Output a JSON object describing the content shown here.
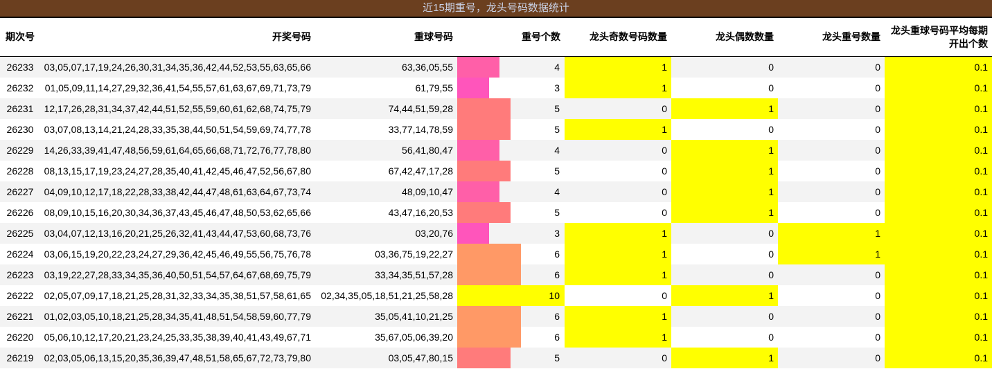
{
  "title": "近15期重号，龙头号码数据统计",
  "headers": {
    "period": "期次号",
    "draw": "开奖号码",
    "repeat": "重球号码",
    "count": "重号个数",
    "head_odd": "龙头奇数号码数量",
    "head_even": "龙头偶数数量",
    "head_repeat": "龙头重号数量",
    "avg_line1": "龙头重球号码平均每期",
    "avg_line2": "开出个数"
  },
  "bar_colors": {
    "3": "#ff55bb",
    "4": "#ff5fa8",
    "5": "#ff7b7b",
    "6": "#ff9966",
    "10": "#ffff00"
  },
  "highlight_color": "#ffff00",
  "rows": [
    {
      "period": "26233",
      "draw": "03,05,07,17,19,24,26,30,31,34,35,36,42,44,52,53,55,63,65,66",
      "repeat": "63,36,05,55",
      "count": 4,
      "odd": "1",
      "even": "0",
      "hrep": "0",
      "avg": "0.1"
    },
    {
      "period": "26232",
      "draw": "01,05,09,11,14,27,29,32,36,41,54,55,57,61,63,67,69,71,73,79",
      "repeat": "61,79,55",
      "count": 3,
      "odd": "1",
      "even": "0",
      "hrep": "0",
      "avg": "0.1"
    },
    {
      "period": "26231",
      "draw": "12,17,26,28,31,34,37,42,44,51,52,55,59,60,61,62,68,74,75,79",
      "repeat": "74,44,51,59,28",
      "count": 5,
      "odd": "0",
      "even": "1",
      "hrep": "0",
      "avg": "0.1"
    },
    {
      "period": "26230",
      "draw": "03,07,08,13,14,21,24,28,33,35,38,44,50,51,54,59,69,74,77,78",
      "repeat": "33,77,14,78,59",
      "count": 5,
      "odd": "1",
      "even": "0",
      "hrep": "0",
      "avg": "0.1"
    },
    {
      "period": "26229",
      "draw": "14,26,33,39,41,47,48,56,59,61,64,65,66,68,71,72,76,77,78,80",
      "repeat": "56,41,80,47",
      "count": 4,
      "odd": "0",
      "even": "1",
      "hrep": "0",
      "avg": "0.1"
    },
    {
      "period": "26228",
      "draw": "08,13,15,17,19,23,24,27,28,35,40,41,42,45,46,47,52,56,67,80",
      "repeat": "67,42,47,17,28",
      "count": 5,
      "odd": "0",
      "even": "1",
      "hrep": "0",
      "avg": "0.1"
    },
    {
      "period": "26227",
      "draw": "04,09,10,12,17,18,22,28,33,38,42,44,47,48,61,63,64,67,73,74",
      "repeat": "48,09,10,47",
      "count": 4,
      "odd": "0",
      "even": "1",
      "hrep": "0",
      "avg": "0.1"
    },
    {
      "period": "26226",
      "draw": "08,09,10,15,16,20,30,34,36,37,43,45,46,47,48,50,53,62,65,66",
      "repeat": "43,47,16,20,53",
      "count": 5,
      "odd": "0",
      "even": "1",
      "hrep": "0",
      "avg": "0.1"
    },
    {
      "period": "26225",
      "draw": "03,04,07,12,13,16,20,21,25,26,32,41,43,44,47,53,60,68,73,76",
      "repeat": "03,20,76",
      "count": 3,
      "odd": "1",
      "even": "0",
      "hrep": "1",
      "avg": "0.1"
    },
    {
      "period": "26224",
      "draw": "03,06,15,19,20,22,23,24,27,29,36,42,45,46,49,55,56,75,76,78",
      "repeat": "03,36,75,19,22,27",
      "count": 6,
      "odd": "1",
      "even": "0",
      "hrep": "1",
      "avg": "0.1"
    },
    {
      "period": "26223",
      "draw": "03,19,22,27,28,33,34,35,36,40,50,51,54,57,64,67,68,69,75,79",
      "repeat": "33,34,35,51,57,28",
      "count": 6,
      "odd": "1",
      "even": "0",
      "hrep": "0",
      "avg": "0.1"
    },
    {
      "period": "26222",
      "draw": "02,05,07,09,17,18,21,25,28,31,32,33,34,35,38,51,57,58,61,65",
      "repeat": "02,34,35,05,18,51,21,25,58,28",
      "count": 10,
      "odd": "0",
      "even": "1",
      "hrep": "0",
      "avg": "0.1"
    },
    {
      "period": "26221",
      "draw": "01,02,03,05,10,18,21,25,28,34,35,41,48,51,54,58,59,60,77,79",
      "repeat": "35,05,41,10,21,25",
      "count": 6,
      "odd": "1",
      "even": "0",
      "hrep": "0",
      "avg": "0.1"
    },
    {
      "period": "26220",
      "draw": "05,06,10,12,17,20,21,23,24,25,33,35,38,39,40,41,43,49,67,71",
      "repeat": "35,67,05,06,39,20",
      "count": 6,
      "odd": "1",
      "even": "0",
      "hrep": "0",
      "avg": "0.1"
    },
    {
      "period": "26219",
      "draw": "02,03,05,06,13,15,20,35,36,39,47,48,51,58,65,67,72,73,79,80",
      "repeat": "03,05,47,80,15",
      "count": 5,
      "odd": "0",
      "even": "1",
      "hrep": "0",
      "avg": "0.1"
    }
  ]
}
